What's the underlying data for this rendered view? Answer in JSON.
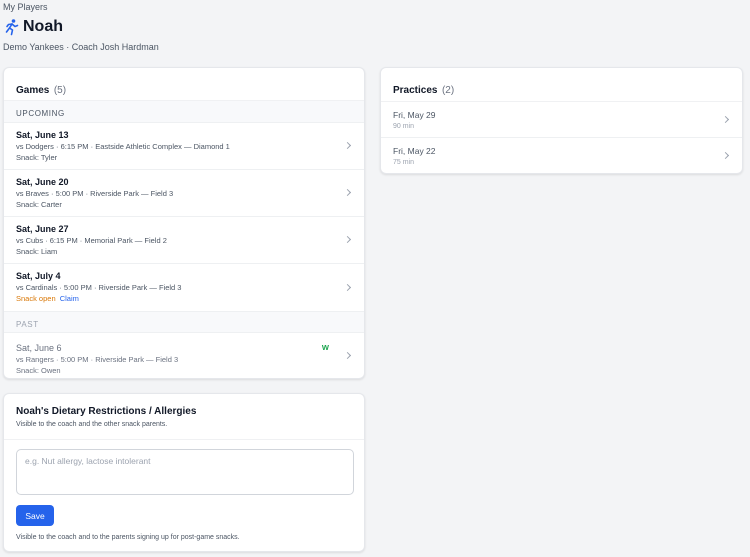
{
  "breadcrumb": "My Players",
  "player": {
    "name": "Noah",
    "icon": "runner-icon",
    "team_line": "Demo Yankees · Coach Josh Hardman"
  },
  "games": {
    "title": "Games",
    "count": "(5)",
    "upcoming_label": "UPCOMING",
    "past_label": "PAST",
    "upcoming": [
      {
        "date": "Sat, June 13",
        "detail": "vs Dodgers · 6:15 PM · Eastside Athletic Complex — Diamond 1",
        "snack": "Snack: Tyler"
      },
      {
        "date": "Sat, June 20",
        "detail": "vs Braves · 5:00 PM · Riverside Park — Field 3",
        "snack": "Snack: Carter"
      },
      {
        "date": "Sat, June 27",
        "detail": "vs Cubs · 6:15 PM · Memorial Park — Field 2",
        "snack": "Snack: Liam"
      },
      {
        "date": "Sat, July 4",
        "detail": "vs Cardinals · 5:00 PM · Riverside Park — Field 3",
        "snack_open": "Snack open",
        "claim": "Claim"
      }
    ],
    "past": [
      {
        "date": "Sat, June 6",
        "detail": "vs Rangers · 5:00 PM · Riverside Park — Field 3",
        "snack": "Snack: Owen",
        "result": "W"
      }
    ]
  },
  "practices": {
    "title": "Practices",
    "count": "(2)",
    "items": [
      {
        "date": "Fri, May 29",
        "duration": "90 min"
      },
      {
        "date": "Fri, May 22",
        "duration": "75 min"
      }
    ]
  },
  "dietary": {
    "title": "Noah's Dietary Restrictions / Allergies",
    "subtitle": "Visible to the coach and the other snack parents.",
    "placeholder": "e.g. Nut allergy, lactose intolerant",
    "value": "",
    "save_label": "Save",
    "footnote": "Visible to the coach and to the parents signing up for post-game snacks."
  },
  "colors": {
    "accent": "#2563eb",
    "snack_open": "#d97706",
    "win": "#16a34a"
  }
}
